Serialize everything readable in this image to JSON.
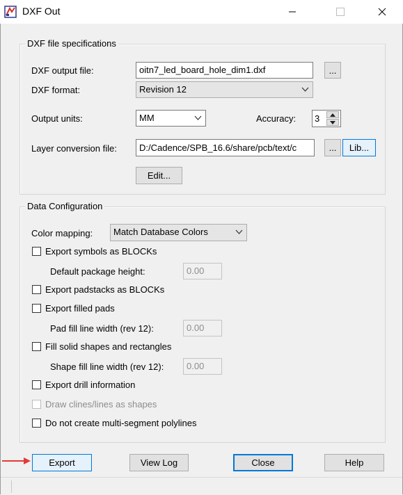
{
  "window": {
    "title": "DXF Out",
    "icon": "dxf-app-icon",
    "controls": [
      "minimize-icon",
      "maximize-icon",
      "close-icon"
    ]
  },
  "spec_group": {
    "title": "DXF file specifications",
    "output_file_label": "DXF output file:",
    "output_file_value": "oitn7_led_board_hole_dim1.dxf",
    "browse_label": "...",
    "format_label": "DXF format:",
    "format_value": "Revision 12",
    "units_label": "Output units:",
    "units_value": "MM",
    "accuracy_label": "Accuracy:",
    "accuracy_value": "3",
    "layer_file_label": "Layer conversion file:",
    "layer_file_value": "D:/Cadence/SPB_16.6/share/pcb/text/c",
    "layer_browse_label": "...",
    "lib_label": "Lib...",
    "edit_label": "Edit..."
  },
  "data_group": {
    "title": "Data Configuration",
    "color_mapping_label": "Color mapping:",
    "color_mapping_value": "Match Database Colors",
    "export_symbols_label": "Export symbols as BLOCKs",
    "default_pkg_height_label": "Default package height:",
    "default_pkg_height_value": "0.00",
    "export_padstacks_label": "Export padstacks as BLOCKs",
    "export_filled_pads_label": "Export filled pads",
    "pad_fill_width_label": "Pad fill line width (rev 12):",
    "pad_fill_width_value": "0.00",
    "fill_solid_label": "Fill solid shapes and rectangles",
    "shape_fill_width_label": "Shape fill line width (rev 12):",
    "shape_fill_width_value": "0.00",
    "export_drill_label": "Export drill information",
    "draw_clines_label": "Draw clines/lines as shapes",
    "no_multiseg_label": "Do not create multi-segment polylines"
  },
  "buttons": {
    "export": "Export",
    "view_log": "View Log",
    "close": "Close",
    "help": "Help"
  },
  "colors": {
    "annotation_arrow": "#e53935",
    "focus_border": "#0078d7"
  }
}
